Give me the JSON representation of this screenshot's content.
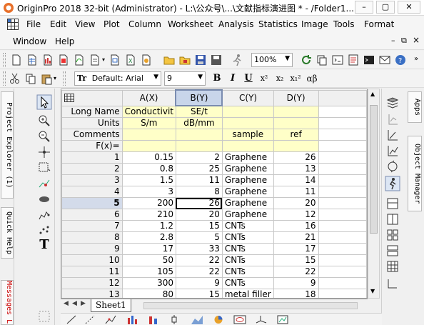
{
  "window": {
    "title": "OriginPro 2018 32-bit (Administrator) - L:\\公众号\\...\\文献指标演进图 * - /Folder1...",
    "buttons": {
      "minimize": "–",
      "restore": "▢",
      "close": "✕"
    }
  },
  "menu": {
    "row1": [
      "File",
      "Edit",
      "View",
      "Plot",
      "Column",
      "Worksheet",
      "Analysis",
      "Statistics",
      "Image",
      "Tools",
      "Format"
    ],
    "row2": [
      "Window",
      "Help"
    ],
    "mdi_controls": [
      "–",
      "⧉",
      "×"
    ]
  },
  "toolbar1": {
    "zoom": "100%"
  },
  "toolbar2": {
    "font_label": "Default: Arial",
    "font_icon": "Tr",
    "font_size": "9",
    "bold": "B",
    "italic": "I",
    "underline": "U",
    "superscript": "x²",
    "subscript": "x₂",
    "supersub": "x₁²",
    "greek": "αβ"
  },
  "left_dock": {
    "tabs": [
      "Project Explorer (1)",
      "Quick Help",
      "Messages L"
    ]
  },
  "right_dock": {
    "tabs": [
      "Apps",
      "Object Manager"
    ]
  },
  "worksheet": {
    "corner_icon": "grid-icon",
    "columns": [
      "A(X)",
      "B(Y)",
      "C(Y)",
      "D(Y)"
    ],
    "selected_column": "B(Y)",
    "meta_rows": [
      {
        "label": "Long Name",
        "values": [
          "Conductivit",
          "SE/t",
          "",
          ""
        ]
      },
      {
        "label": "Units",
        "values": [
          "S/m",
          "dB/mm",
          "",
          ""
        ]
      },
      {
        "label": "Comments",
        "values": [
          "",
          "",
          "sample",
          "ref"
        ]
      },
      {
        "label": "F(x)=",
        "values": [
          "",
          "",
          "",
          ""
        ]
      }
    ],
    "rows": [
      {
        "n": "1",
        "a": "0.15",
        "b": "2",
        "c": "Graphene",
        "d": "26"
      },
      {
        "n": "2",
        "a": "0.8",
        "b": "25",
        "c": "Graphene",
        "d": "13"
      },
      {
        "n": "3",
        "a": "1.5",
        "b": "11",
        "c": "Graphene",
        "d": "14"
      },
      {
        "n": "4",
        "a": "3",
        "b": "8",
        "c": "Graphene",
        "d": "11"
      },
      {
        "n": "5",
        "a": "200",
        "b": "26",
        "c": "Graphene",
        "d": "20"
      },
      {
        "n": "6",
        "a": "210",
        "b": "20",
        "c": "Graphene",
        "d": "12"
      },
      {
        "n": "7",
        "a": "1.2",
        "b": "15",
        "c": "CNTs",
        "d": "16"
      },
      {
        "n": "8",
        "a": "2.8",
        "b": "5",
        "c": "CNTs",
        "d": "21"
      },
      {
        "n": "9",
        "a": "17",
        "b": "33",
        "c": "CNTs",
        "d": "17"
      },
      {
        "n": "10",
        "a": "50",
        "b": "22",
        "c": "CNTs",
        "d": "15"
      },
      {
        "n": "11",
        "a": "105",
        "b": "22",
        "c": "CNTs",
        "d": "22"
      },
      {
        "n": "12",
        "a": "300",
        "b": "9",
        "c": "CNTs",
        "d": "9"
      },
      {
        "n": "13",
        "a": "80",
        "b": "15",
        "c": "metal filler",
        "d": "18"
      }
    ],
    "selected_row": "5",
    "sheet_tab": "Sheet1"
  },
  "colors": {
    "meta_background": "#ffffc8",
    "selected_header": "#c8d5ea",
    "selected_row": "#d3dbea"
  }
}
